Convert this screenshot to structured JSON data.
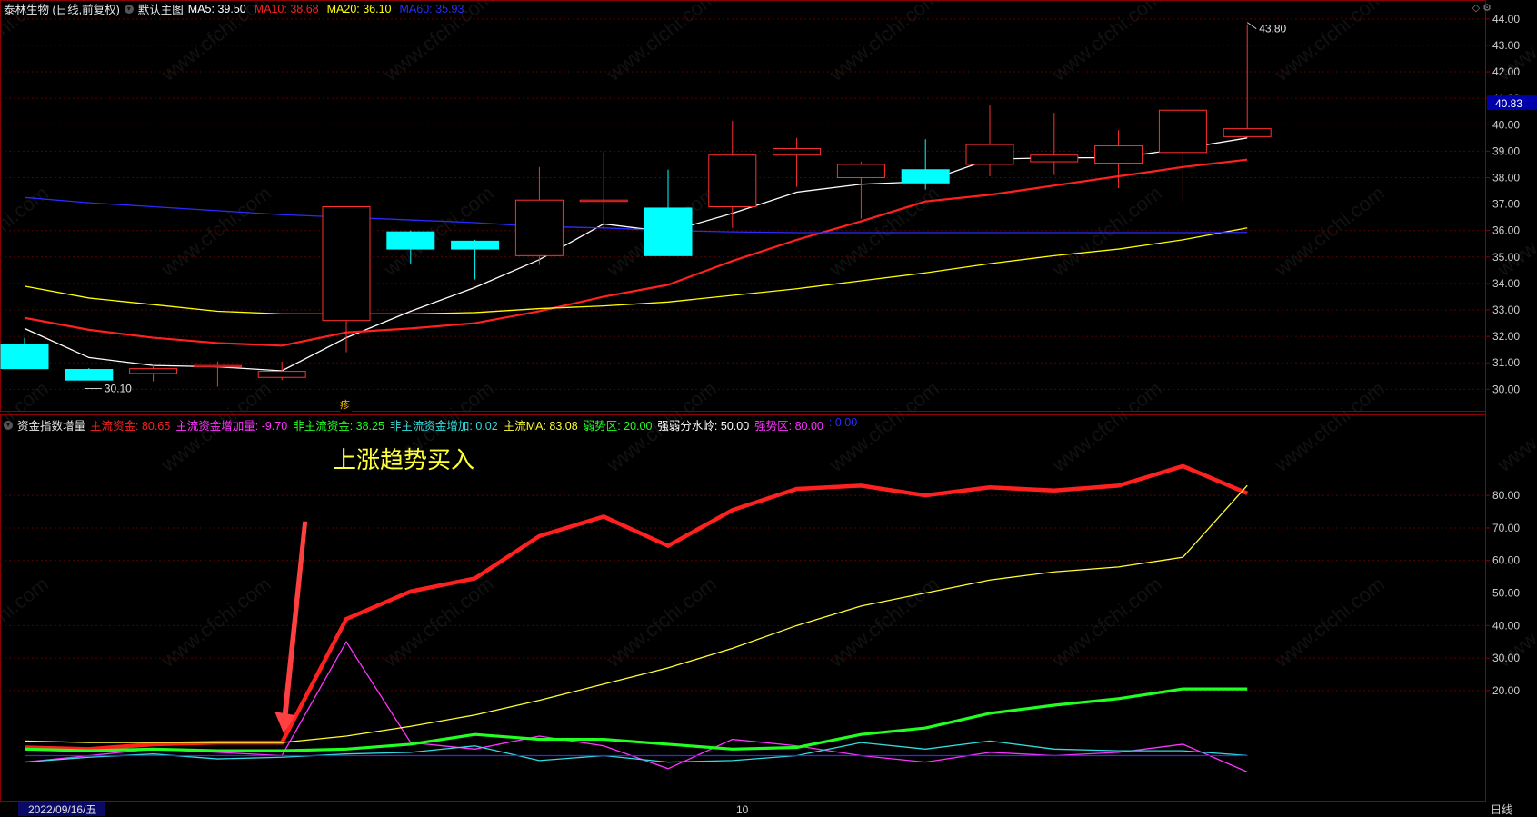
{
  "main_header": {
    "title": "泰林生物 (日线,前复权)",
    "chart_mode": "默认主图",
    "indicators": [
      {
        "label": "MA5: 39.50",
        "color": "#ffffff"
      },
      {
        "label": "MA10: 38.68",
        "color": "#ff2020"
      },
      {
        "label": "MA20: 36.10",
        "color": "#ffff00"
      },
      {
        "label": "MA60: 35.93",
        "color": "#2b2bff"
      }
    ]
  },
  "sub_header": {
    "title": "资金指数增量",
    "indicators": [
      {
        "label": "主流资金: 80.65",
        "color": "#ff2020"
      },
      {
        "label": "主流资金增加量: -9.70",
        "color": "#ff33ff"
      },
      {
        "label": "非主流资金: 38.25",
        "color": "#22ff22"
      },
      {
        "label": "非主流资金增加: 0.02",
        "color": "#33dddd"
      },
      {
        "label": "主流MA: 83.08",
        "color": "#ffff33"
      },
      {
        "label": "弱势区: 20.00",
        "color": "#22ff22"
      },
      {
        "label": "强弱分水岭: 50.00",
        "color": "#ffffff"
      },
      {
        "label": "强势区: 80.00",
        "color": "#ff33ff"
      },
      {
        "label": ": 0.00",
        "color": "#2b2bff"
      }
    ]
  },
  "annotation": {
    "text": "上涨趋势买入",
    "color": "#ffff3b"
  },
  "small_marker": "疹",
  "bottom_bar": {
    "date_label": "2022/09/16/五",
    "month_tick": "10",
    "period": "日线"
  },
  "chart_data": [
    {
      "type": "candlestick",
      "title": "泰林生物 (日线,前复权)",
      "ylim": [
        29.6,
        44.2
      ],
      "y_ticks": [
        "30.00",
        "31.00",
        "32.00",
        "33.00",
        "34.00",
        "35.00",
        "36.00",
        "37.00",
        "38.00",
        "39.00",
        "40.00",
        "41.00",
        "42.00",
        "43.00",
        "44.00"
      ],
      "current_price_label": "40.83",
      "annotations": [
        {
          "text": "30.10",
          "index": 1,
          "value": 30.1
        },
        {
          "text": "43.80",
          "index": 19,
          "value": 43.8
        }
      ],
      "candles": [
        {
          "o": 31.7,
          "h": 31.95,
          "l": 30.78,
          "c": 30.78
        },
        {
          "o": 30.75,
          "h": 30.8,
          "l": 30.35,
          "c": 30.35
        },
        {
          "o": 30.6,
          "h": 30.95,
          "l": 30.3,
          "c": 30.78
        },
        {
          "o": 30.9,
          "h": 31.05,
          "l": 30.1,
          "c": 30.9
        },
        {
          "o": 30.45,
          "h": 31.05,
          "l": 30.35,
          "c": 30.68
        },
        {
          "o": 32.6,
          "h": 36.9,
          "l": 31.4,
          "c": 36.9
        },
        {
          "o": 35.95,
          "h": 36.0,
          "l": 34.75,
          "c": 35.3
        },
        {
          "o": 35.6,
          "h": 35.65,
          "l": 34.15,
          "c": 35.3
        },
        {
          "o": 35.05,
          "h": 38.4,
          "l": 34.7,
          "c": 37.15
        },
        {
          "o": 37.15,
          "h": 38.95,
          "l": 36.05,
          "c": 37.15
        },
        {
          "o": 36.85,
          "h": 38.3,
          "l": 35.05,
          "c": 35.05
        },
        {
          "o": 36.9,
          "h": 40.15,
          "l": 36.1,
          "c": 38.85
        },
        {
          "o": 38.85,
          "h": 39.5,
          "l": 37.65,
          "c": 39.1
        },
        {
          "o": 38.0,
          "h": 38.6,
          "l": 36.45,
          "c": 38.5
        },
        {
          "o": 38.3,
          "h": 39.45,
          "l": 37.55,
          "c": 37.8
        },
        {
          "o": 38.5,
          "h": 40.75,
          "l": 38.05,
          "c": 39.25
        },
        {
          "o": 38.6,
          "h": 40.45,
          "l": 38.1,
          "c": 38.85
        },
        {
          "o": 38.55,
          "h": 39.8,
          "l": 37.6,
          "c": 39.2
        },
        {
          "o": 38.95,
          "h": 40.75,
          "l": 37.1,
          "c": 40.55
        },
        {
          "o": 39.55,
          "h": 43.8,
          "l": 39.5,
          "c": 39.85
        }
      ],
      "series": [
        {
          "name": "MA5",
          "color": "#ffffff",
          "values": [
            32.3,
            31.2,
            30.9,
            30.85,
            30.7,
            31.95,
            32.95,
            33.85,
            34.9,
            36.25,
            35.95,
            36.65,
            37.45,
            37.75,
            37.85,
            38.7,
            38.75,
            38.75,
            39.1,
            39.5
          ]
        },
        {
          "name": "MA10",
          "color": "#ff2020",
          "values": [
            32.7,
            32.25,
            31.95,
            31.75,
            31.65,
            32.15,
            32.3,
            32.5,
            32.95,
            33.5,
            33.95,
            34.85,
            35.65,
            36.35,
            37.1,
            37.35,
            37.7,
            38.05,
            38.4,
            38.68
          ]
        },
        {
          "name": "MA20",
          "color": "#ffff00",
          "values": [
            33.9,
            33.45,
            33.2,
            32.95,
            32.85,
            32.85,
            32.85,
            32.9,
            33.05,
            33.15,
            33.3,
            33.55,
            33.8,
            34.1,
            34.4,
            34.75,
            35.05,
            35.3,
            35.65,
            36.1
          ]
        },
        {
          "name": "MA60",
          "color": "#2b2bff",
          "values": [
            37.25,
            37.05,
            36.9,
            36.75,
            36.6,
            36.5,
            36.4,
            36.3,
            36.15,
            36.1,
            36.0,
            35.95,
            35.92,
            35.92,
            35.92,
            35.92,
            35.92,
            35.92,
            35.92,
            35.93
          ]
        }
      ]
    },
    {
      "type": "line",
      "title": "资金指数增量",
      "ylim": [
        -13,
        101
      ],
      "y_ticks": [
        "20.00",
        "30.00",
        "40.00",
        "50.00",
        "60.00",
        "70.00",
        "80.00"
      ],
      "callout": {
        "text": "上涨趋势买入",
        "target_index": 4
      },
      "series": [
        {
          "name": "主流资金",
          "color": "#ff2020",
          "values": [
            2.5,
            2.0,
            3.5,
            4.0,
            4.0,
            42,
            50.5,
            54.5,
            67.5,
            73.5,
            64.5,
            75.5,
            82,
            83,
            80,
            82.5,
            81.5,
            83,
            89,
            80.65
          ]
        },
        {
          "name": "主流资金增加量",
          "color": "#ff33ff",
          "values": [
            -2,
            0,
            2,
            1,
            0,
            35,
            4,
            2,
            6,
            3,
            -4,
            5,
            3,
            0,
            -2,
            1,
            0,
            1,
            3.5,
            -5
          ]
        },
        {
          "name": "非主流资金",
          "color": "#22ff22",
          "values": [
            2,
            1.5,
            2,
            1.5,
            1.5,
            2,
            3.5,
            6.5,
            5,
            5,
            3.5,
            2,
            2.5,
            6.5,
            8.5,
            13,
            15.5,
            17.5,
            20.5,
            20.5
          ]
        },
        {
          "name": "非主流资金增加",
          "color": "#33dddd",
          "values": [
            -2,
            -0.5,
            0.5,
            -1,
            -0.5,
            0.5,
            1,
            3,
            -1.5,
            0,
            -2,
            -1.5,
            0,
            4,
            2,
            4.5,
            2,
            1.5,
            1.5,
            0.02
          ]
        },
        {
          "name": "主流MA",
          "color": "#ffff33",
          "values": [
            4.5,
            4.0,
            4.0,
            4.0,
            4.0,
            6,
            9,
            12.5,
            17,
            22,
            27,
            33,
            40,
            46,
            50,
            54,
            56.5,
            58,
            61,
            83.08
          ]
        },
        {
          "name": "",
          "color": "#2b2bff",
          "values": [
            0,
            0,
            0,
            0,
            0,
            0,
            0,
            0,
            0,
            0,
            0,
            0,
            0,
            0,
            0,
            0,
            0,
            0,
            0,
            0
          ]
        }
      ]
    }
  ]
}
